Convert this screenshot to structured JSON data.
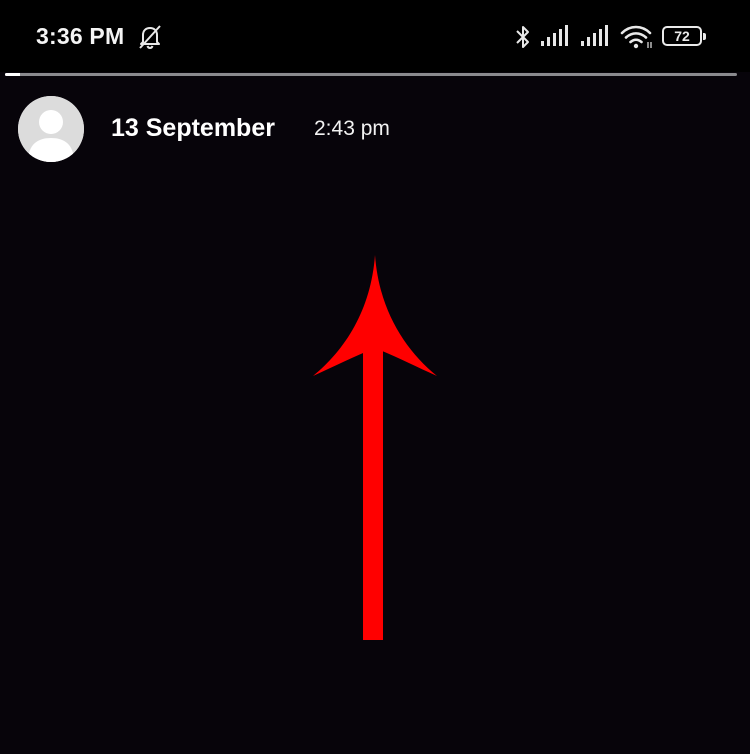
{
  "status_bar": {
    "time": "3:36 PM",
    "icons": [
      "bell-off-icon",
      "bluetooth-icon",
      "signal-icon",
      "signal-icon",
      "wifi-icon",
      "battery-icon"
    ],
    "battery_level": "72"
  },
  "story": {
    "progress_fraction": 0.02,
    "date": "13 September",
    "time": "2:43 pm"
  },
  "annotation": {
    "arrow_color": "#ff0000",
    "arrow_direction": "up"
  }
}
